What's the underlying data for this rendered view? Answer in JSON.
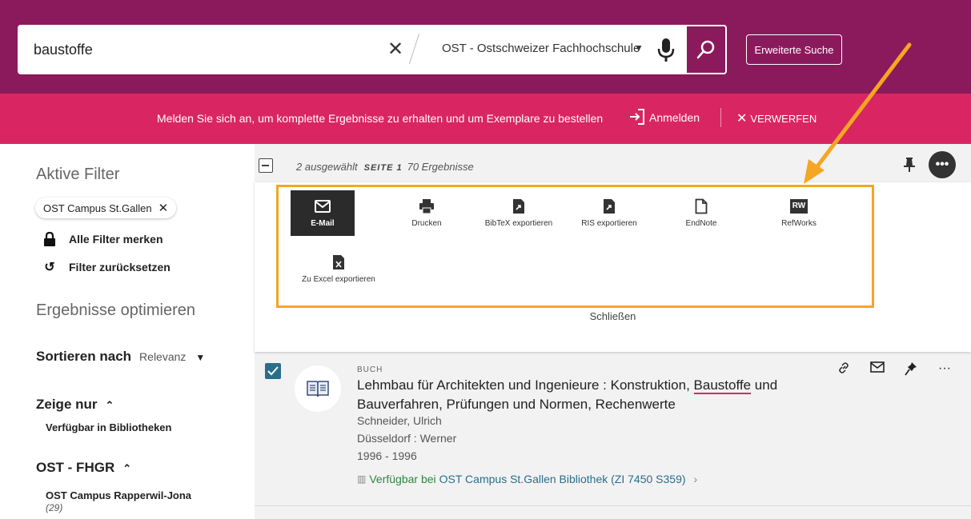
{
  "search": {
    "query": "baustoffe",
    "scope": "OST - Ostschweizer Fachhochschule",
    "advanced_label": "Erweiterte Suche"
  },
  "banner": {
    "text": "Melden Sie sich an, um komplette Ergebnisse zu erhalten und um Exemplare zu bestellen",
    "login_label": "Anmelden",
    "dismiss_label": "VERWERFEN"
  },
  "sidebar": {
    "active_filters_title": "Aktive Filter",
    "chip_label": "OST Campus St.Gallen",
    "keep_filters": "Alle Filter merken",
    "reset_filters": "Filter zurücksetzen",
    "optimize_title": "Ergebnisse optimieren",
    "sort_label": "Sortieren nach",
    "sort_value": "Relevanz",
    "show_only_title": "Zeige nur",
    "show_only_item": "Verfügbar in Bibliotheken",
    "fhgr_title": "OST - FHGR",
    "fhgr_item": "OST Campus Rapperwil-Jona",
    "fhgr_count": "(29)"
  },
  "results": {
    "selected": "2 ausgewählt",
    "page_label": "SEITE 1",
    "count": "70 Ergebnisse",
    "more_label": "•••",
    "actions": [
      {
        "label": "E-Mail"
      },
      {
        "label": "Drucken"
      },
      {
        "label": "BibTeX exportieren"
      },
      {
        "label": "RIS exportieren"
      },
      {
        "label": "EndNote"
      },
      {
        "label": "RefWorks",
        "badge": "RW"
      },
      {
        "label": "Zu Excel exportieren"
      }
    ],
    "close_label": "Schließen"
  },
  "item": {
    "type": "BUCH",
    "title_before": "Lehmbau für Architekten und Ingenieure : Konstruktion, ",
    "title_highlight": "Baustoffe",
    "title_after": " und Bauverfahren, Prüfungen und Normen, Rechenwerte",
    "author": "Schneider, Ulrich",
    "publisher": "Düsseldorf : Werner",
    "years": "1996 - 1996",
    "availability": "Verfügbar bei",
    "location": "OST Campus St.Gallen  Bibliothek (ZI 7450 S359)",
    "more_label": "···"
  },
  "colors": {
    "header": "#8b1a5c",
    "banner": "#d92663",
    "highlight": "#f5a623",
    "available": "#2e8540",
    "link": "#2a6e8a"
  }
}
